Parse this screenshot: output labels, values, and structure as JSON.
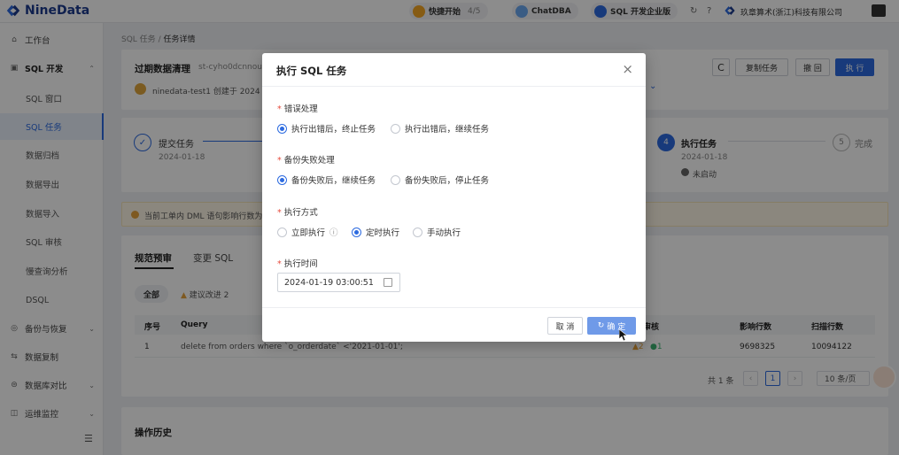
{
  "topbar": {
    "logo_text": "NineData",
    "quick_start": "快捷开始",
    "quick_start_progress": "4/5",
    "chatdba": "ChatDBA",
    "edition": "SQL 开发企业版",
    "org": "玖章算术(浙江)科技有限公司"
  },
  "sidebar": {
    "items": [
      {
        "icon": "⌂",
        "label": "工作台"
      },
      {
        "icon": "▣",
        "label": "SQL 开发"
      },
      {
        "label": "SQL 窗口"
      },
      {
        "label": "SQL 任务"
      },
      {
        "label": "数据归档"
      },
      {
        "label": "数据导出"
      },
      {
        "label": "数据导入"
      },
      {
        "label": "SQL 审核"
      },
      {
        "label": "慢查询分析"
      },
      {
        "label": "DSQL"
      },
      {
        "icon": "◎",
        "label": "备份与恢复"
      },
      {
        "icon": "⇆",
        "label": "数据复制"
      },
      {
        "icon": "⊜",
        "label": "数据库对比"
      },
      {
        "icon": "◫",
        "label": "运维监控"
      }
    ],
    "collapse": "☰"
  },
  "breadcrumb": {
    "parent": "SQL 任务",
    "sep": "/",
    "current": "任务详情"
  },
  "task": {
    "name": "过期数据清理",
    "id": "st-cyho0dcnnou",
    "creator": "ninedata-test1 创建于 2024",
    "refresh": "C",
    "copy": "复制任务",
    "revoke": "撤 回",
    "execute": "执 行"
  },
  "steps": [
    {
      "label": "提交任务",
      "date": "2024-01-18"
    },
    {
      "num": "4",
      "label": "执行任务",
      "date": "2024-01-18",
      "status": "未启动"
    },
    {
      "num": "5",
      "label": "完成"
    }
  ],
  "notice": "当前工单内 DML 语句影响行数为",
  "tabs": {
    "a": "规范预审",
    "b": "变更 SQL"
  },
  "filters": {
    "all": "全部",
    "suggest": "建议改进 2"
  },
  "table": {
    "headers": [
      "序号",
      "Query",
      "审核",
      "影响行数",
      "扫描行数"
    ],
    "row": {
      "no": "1",
      "query": "delete from orders where `o_orderdate` <'2021-01-01';",
      "warn": "2",
      "ok": "1",
      "affected": "9698325",
      "scanned": "10094122"
    }
  },
  "pagination": {
    "total": "共 1 条",
    "page": "1",
    "size": "10 条/页"
  },
  "history": "操作历史",
  "modal": {
    "title": "执行 SQL 任务",
    "error_label": "错误处理",
    "error_opt1": "执行出错后，终止任务",
    "error_opt2": "执行出错后，继续任务",
    "backup_label": "备份失败处理",
    "backup_opt1": "备份失败后，继续任务",
    "backup_opt2": "备份失败后，停止任务",
    "mode_label": "执行方式",
    "mode_opt1": "立即执行",
    "mode_opt2": "定时执行",
    "mode_opt3": "手动执行",
    "time_label": "执行时间",
    "time_value": "2024-01-19 03:00:51",
    "cancel": "取 消",
    "ok": "确 定"
  },
  "colors": {
    "primary": "#2d6be0",
    "danger": "#e64a3c",
    "warn": "#e6a23c",
    "success": "#3cb371"
  }
}
